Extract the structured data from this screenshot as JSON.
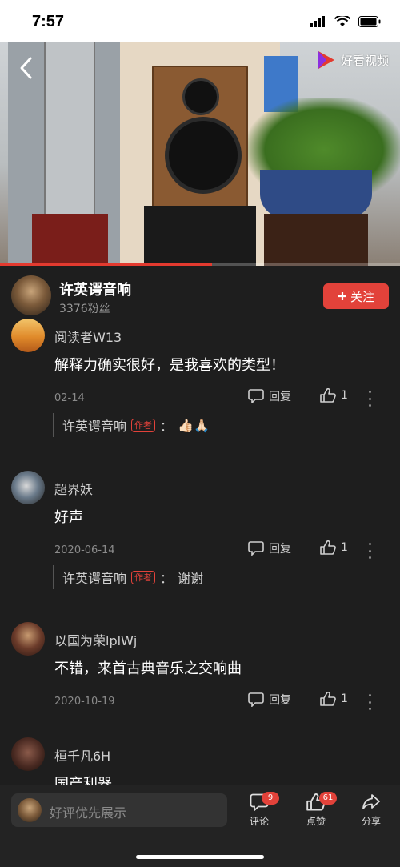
{
  "status_bar": {
    "time": "7:57"
  },
  "video": {
    "brand": "好看视频",
    "progress": 0.53
  },
  "author": {
    "name": "许英谔音响",
    "fans": "3376粉丝",
    "follow_label": "关注"
  },
  "comments": [
    {
      "user": "阅读者W13",
      "text": "解释力确实很好，是我喜欢的类型！",
      "date": "02-14",
      "reply_label": "回复",
      "likes": "1",
      "author_reply": {
        "name": "许英谔音响",
        "badge": "作者",
        "colon": "：",
        "text": "👍🏻🙏🏻"
      }
    },
    {
      "user": "超界妖",
      "text": "好声",
      "date": "2020-06-14",
      "reply_label": "回复",
      "likes": "1",
      "author_reply": {
        "name": "许英谔音响",
        "badge": "作者",
        "colon": "：",
        "text": "谢谢"
      }
    },
    {
      "user": "以国为荣lplWj",
      "text": "不错，来首古典音乐之交响曲",
      "date": "2020-10-19",
      "reply_label": "回复",
      "likes": "1"
    },
    {
      "user": "桓千凡6H",
      "text": "国产利器"
    }
  ],
  "bottom_bar": {
    "placeholder": "好评优先展示",
    "comment": {
      "label": "评论",
      "count": "9"
    },
    "like": {
      "label": "点赞",
      "count": "61"
    },
    "share": {
      "label": "分享"
    }
  },
  "colors": {
    "accent": "#e2423a",
    "background": "#1e1e1e"
  }
}
